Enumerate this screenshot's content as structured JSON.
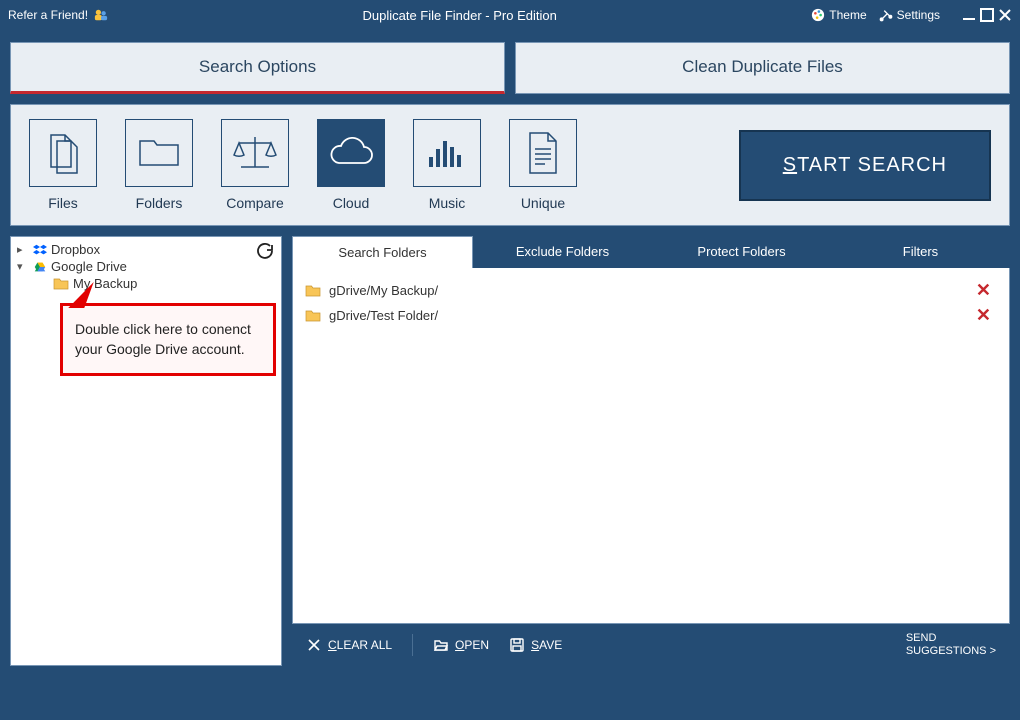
{
  "titlebar": {
    "refer": "Refer a Friend!",
    "title": "Duplicate File Finder - Pro Edition",
    "theme": "Theme",
    "settings": "Settings"
  },
  "ribbon": {
    "tabs": [
      "Search Options",
      "Clean Duplicate Files"
    ],
    "active": 0
  },
  "categories": {
    "items": [
      {
        "id": "files",
        "label": "Files"
      },
      {
        "id": "folders",
        "label": "Folders"
      },
      {
        "id": "compare",
        "label": "Compare"
      },
      {
        "id": "cloud",
        "label": "Cloud"
      },
      {
        "id": "music",
        "label": "Music"
      },
      {
        "id": "unique",
        "label": "Unique"
      }
    ],
    "active": "cloud",
    "start_prefix": "S",
    "start_rest": "TART SEARCH"
  },
  "tree": {
    "dropbox": "Dropbox",
    "gdrive": "Google Drive",
    "children": [
      "My Backup"
    ]
  },
  "callout": {
    "text": "Double click here to conenct your Google Drive account."
  },
  "subtabs": {
    "items": [
      "Search Folders",
      "Exclude Folders",
      "Protect Folders",
      "Filters"
    ],
    "active": 0
  },
  "folders": [
    "gDrive/My Backup/",
    "gDrive/Test Folder/"
  ],
  "bottom": {
    "clear_u": "C",
    "clear_rest": "LEAR ALL",
    "open_u": "O",
    "open_rest": "PEN",
    "save_u": "S",
    "save_rest": "AVE",
    "send_line1": "SEND",
    "send_line2": "SUGGESTIONS >"
  }
}
